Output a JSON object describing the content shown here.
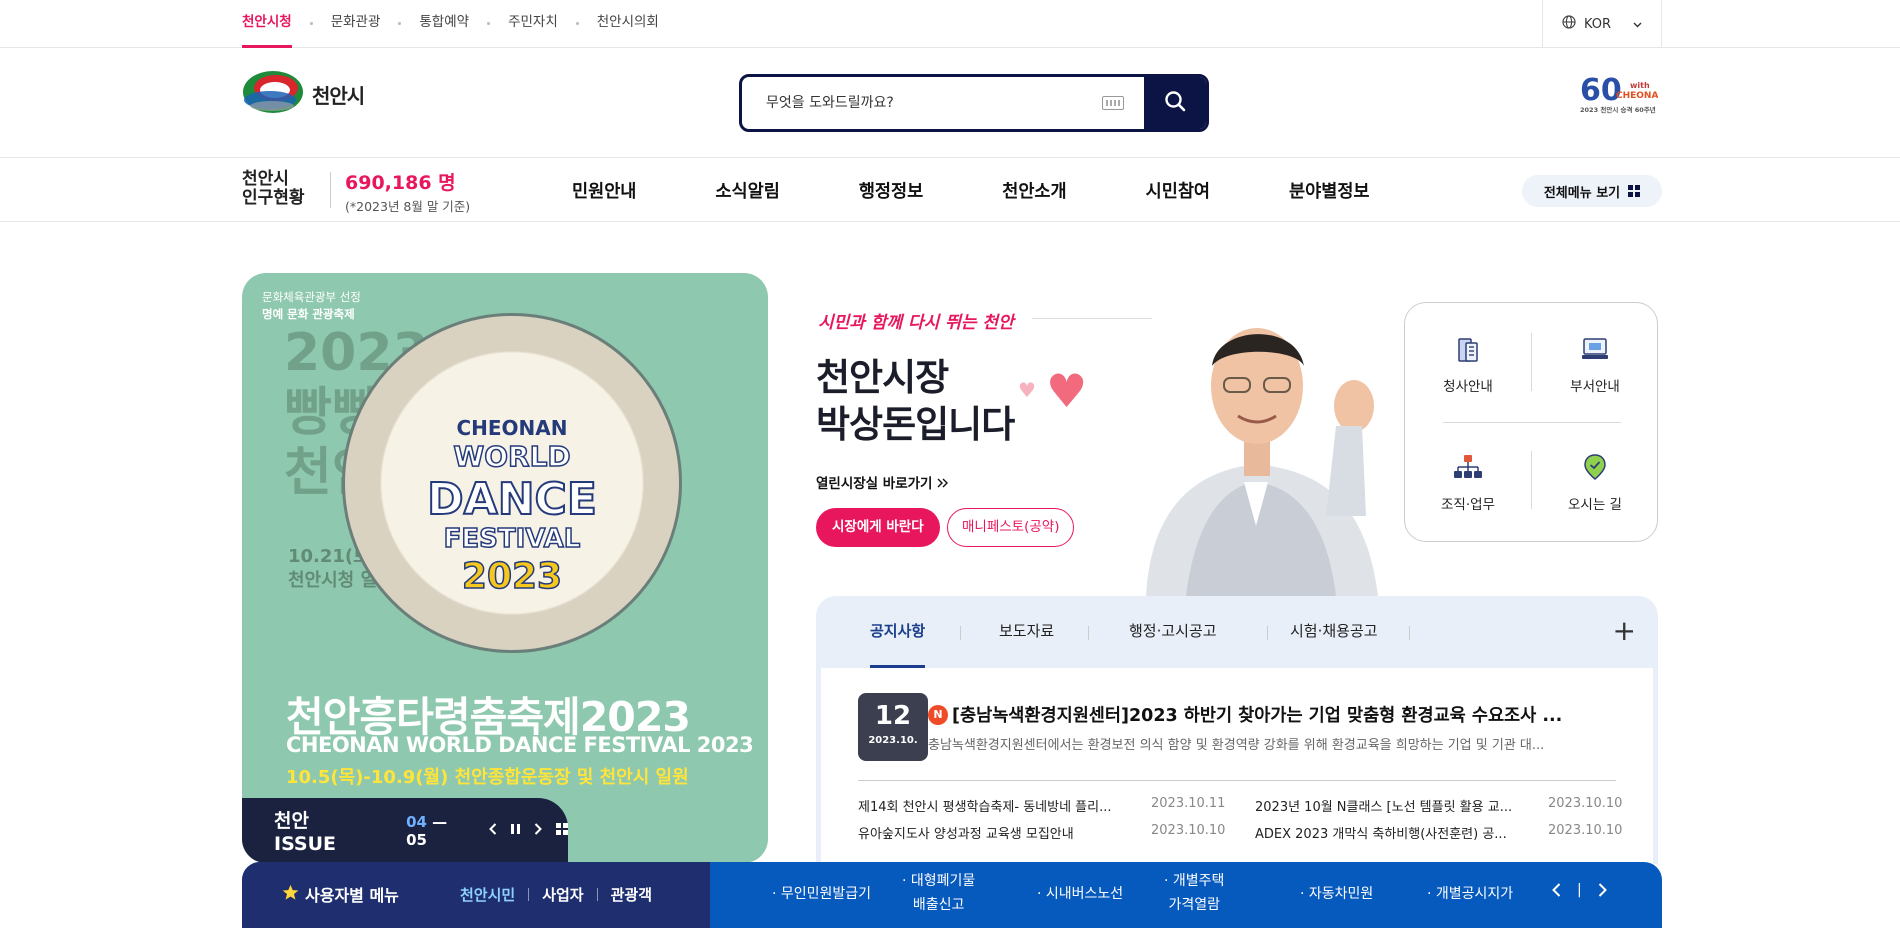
{
  "top_links": [
    "천안시청",
    "문화관광",
    "통합예약",
    "주민자치",
    "천안시의회"
  ],
  "language": {
    "label": "KOR"
  },
  "logo": {
    "text": "천안시"
  },
  "search": {
    "placeholder": "무엇을 도와드릴까요?"
  },
  "anniversary": {
    "number": "60",
    "tag": "with CHEONAN",
    "caption": "2023 천안시 승격 60주년"
  },
  "population": {
    "label_line1": "천안시",
    "label_line2": "인구현황",
    "value": "690,186 명",
    "date": "(*2023년 8월 말 기준)"
  },
  "main_menu": [
    "민원안내",
    "소식알림",
    "행정정보",
    "천안소개",
    "시민참여",
    "분야별정보"
  ],
  "all_menu": {
    "label": "전체메뉴 보기"
  },
  "banner": {
    "sub1": "문화체육관광부 선정",
    "sub2": "명예 문화 관광축제",
    "ghost_line1": "2023",
    "ghost_line2": "빵빵",
    "ghost_line3": "천안",
    "circle_line1": "CHEONAN",
    "circle_line2": "WORLD",
    "circle_line3": "DANCE",
    "circle_line4": "FESTIVAL",
    "circle_line5": "2023",
    "ghost_date1": "10.21(토)",
    "ghost_date2": "천안시청 일원",
    "title_kr": "천안흥타령춤축제2023",
    "title_en": "CHEONAN WORLD DANCE FESTIVAL 2023",
    "date": "10.5(목)-10.9(월) 천안종합운동장 및 천안시 일원"
  },
  "issue": {
    "title": "천안 ISSUE",
    "current": "04",
    "separator": "—",
    "total": "05"
  },
  "mayor": {
    "slogan": "시민과 함께 다시 뛰는 천안",
    "title_line1": "천안시장",
    "title_line2": "박상돈입니다",
    "link": "열린시장실 바로가기",
    "btn_primary": "시장에게 바란다",
    "btn_secondary": "매니페스토(공약)"
  },
  "quick_links": [
    "청사안내",
    "부서안내",
    "조직·업무",
    "오시는 길"
  ],
  "notice": {
    "tabs": [
      "공지사항",
      "보도자료",
      "행정·고시공고",
      "시험·채용공고"
    ],
    "more_label": "+",
    "featured": {
      "day": "12",
      "year_month": "2023.10.",
      "badge": "N",
      "title": "[충남녹색환경지원센터]2023 하반기 찾아가는 기업 맞춤형 환경교육 수요조사 ...",
      "desc": "충남녹색환경지원센터에서는 환경보전 의식 함양 및 환경역량 강화를 위해 환경교육을 희망하는 기업 및 기관 대..."
    },
    "items": [
      {
        "title": "제14회 천안시 평생학습축제- 동네방네 플리...",
        "date": "2023.10.11"
      },
      {
        "title": "2023년 10월 N클래스 [노선 템플릿 활용 교...",
        "date": "2023.10.10"
      },
      {
        "title": "유아숲지도사 양성과정 교육생 모집안내",
        "date": "2023.10.10"
      },
      {
        "title": "ADEX 2023 개막식 축하비행(사전훈련) 공...",
        "date": "2023.10.10"
      }
    ]
  },
  "user_menu": {
    "title": "사용자별 메뉴",
    "tabs": [
      "천안시민",
      "사업자",
      "관광객"
    ],
    "items": [
      {
        "line1": "무인민원발급기",
        "line2": ""
      },
      {
        "line1": "대형폐기물",
        "line2": "배출신고"
      },
      {
        "line1": "시내버스노선",
        "line2": ""
      },
      {
        "line1": "개별주택",
        "line2": "가격열람"
      },
      {
        "line1": "자동차민원",
        "line2": ""
      },
      {
        "line1": "개별공시지가",
        "line2": ""
      }
    ],
    "separator": "|"
  },
  "colors": {
    "accent_pink": "#e8175d",
    "navy": "#0b1445",
    "blue_bar": "#0659bd"
  }
}
